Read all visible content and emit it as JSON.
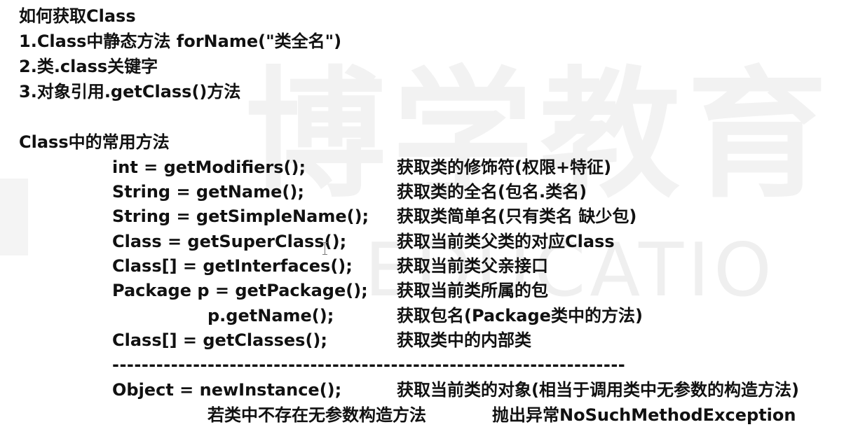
{
  "watermark": {
    "chinese": "博学教育",
    "english": "EDUCATIO"
  },
  "heading1": "如何获取Class",
  "ways": [
    "1.Class中静态方法  forName(\"类全名\")",
    "2.类.class关键字",
    "3.对象引用.getClass()方法"
  ],
  "heading2": "Class中的常用方法",
  "methods": [
    {
      "method": "int = getModifiers();",
      "desc": "获取类的修饰符(权限+特征)"
    },
    {
      "method": "String = getName();",
      "desc": "获取类的全名(包名.类名)"
    },
    {
      "method": "String = getSimpleName();",
      "desc": "获取类简单名(只有类名 缺少包)"
    },
    {
      "method": "Class = getSuperClass();",
      "desc": "获取当前类父类的对应Class"
    },
    {
      "method": "Class[] = getInterfaces();",
      "desc": "获取当前类父亲接口"
    },
    {
      "method": "Package p = getPackage();",
      "desc": "获取当前类所属的包"
    },
    {
      "method": "p.getName();",
      "desc": "获取包名(Package类中的方法)"
    },
    {
      "method": "Class[] = getClasses();",
      "desc": "获取类中的内部类"
    }
  ],
  "divider": "----------------------------------------------------------------------",
  "instance": {
    "method": "Object = newInstance();",
    "desc": "获取当前类的对象(相当于调用类中无参数的构造方法)",
    "note_left": "若类中不存在无参数构造方法",
    "note_right": "抛出异常NoSuchMethodException"
  }
}
